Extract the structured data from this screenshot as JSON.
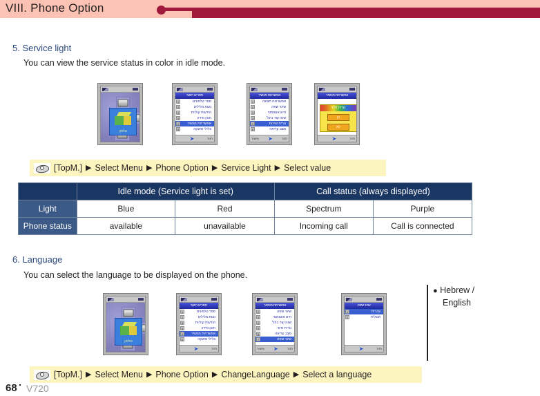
{
  "header": {
    "title": "VIII. Phone Option",
    "band_color": "#fcc3b4",
    "accent_color": "#a0183c"
  },
  "sections": [
    {
      "id": "service-light",
      "heading": "5. Service light",
      "description": "You can view the service status in color in idle mode."
    },
    {
      "id": "language",
      "heading": "6. Language",
      "description": "You can select the language to be displayed on the phone."
    }
  ],
  "phones_service_light": [
    {
      "type": "idle",
      "icon_label": "טלפון",
      "status_signal": "signal-icon",
      "status_battery": "battery-icon"
    },
    {
      "type": "menu",
      "title": "תפריט ראשי",
      "items": [
        {
          "num": "1",
          "text": "ספר טלפונים",
          "selected": false
        },
        {
          "num": "2",
          "text": "נעות מלילים",
          "selected": false
        },
        {
          "num": "3",
          "text": "הודעות קוליות",
          "selected": false
        },
        {
          "num": "4",
          "text": "תוכן מידע",
          "selected": false
        },
        {
          "num": "5",
          "text": "אפשרויות מכשיר",
          "selected": true
        },
        {
          "num": "6",
          "text": "צלילי אזעקה",
          "selected": false
        }
      ],
      "soft_left": "",
      "soft_right": "חזור"
    },
    {
      "type": "menu",
      "title": "אפשרויות מכשיר",
      "items": [
        {
          "num": "1",
          "text": "אפשרויות תצוגה",
          "selected": false
        },
        {
          "num": "2",
          "text": "שינוי שפה",
          "selected": false
        },
        {
          "num": "3",
          "text": "חיוג אוטומטי",
          "selected": false
        },
        {
          "num": "4",
          "text": "שנה קוד בינל'",
          "selected": false
        },
        {
          "num": "5",
          "text": "נורית שירות",
          "selected": true
        },
        {
          "num": "6",
          "text": "מצב קריאה",
          "selected": false
        }
      ],
      "soft_left": "אישור",
      "soft_right": "חזור"
    },
    {
      "type": "popup",
      "title": "אפשרויות מכשיר",
      "popup_title": "נורית חיווי",
      "buttons": [
        "כן",
        "לא"
      ],
      "soft_left": "",
      "soft_right": "חזור"
    }
  ],
  "nav_service_light": {
    "icon": "mouse-click-icon",
    "steps": [
      "[TopM.]",
      "Select Menu",
      "Phone Option",
      "Service Light",
      "Select value"
    ],
    "separator": "▶"
  },
  "table": {
    "group_headers": [
      {
        "label": "",
        "span": 1
      },
      {
        "label": "Idle mode (Service light is set)",
        "span": 2
      },
      {
        "label": "Call status (always displayed)",
        "span": 2
      }
    ],
    "rows": [
      {
        "label": "Light",
        "cells": [
          "Blue",
          "Red",
          "Spectrum",
          "Purple"
        ]
      },
      {
        "label": "Phone status",
        "cells": [
          "available",
          "unavailable",
          "Incoming call",
          "Call is connected"
        ]
      }
    ],
    "header_color": "#1a3663",
    "rowhdr_color": "#3c5a87"
  },
  "phones_language": [
    {
      "type": "idle",
      "icon_label": "טלפון"
    },
    {
      "type": "menu",
      "title": "תפריט ראשי",
      "items": [
        {
          "num": "1",
          "text": "ספר טלפונים",
          "selected": false
        },
        {
          "num": "2",
          "text": "נעות מלילים",
          "selected": false
        },
        {
          "num": "3",
          "text": "הודעות קוליות",
          "selected": false
        },
        {
          "num": "4",
          "text": "תוכן מידע",
          "selected": false
        },
        {
          "num": "5",
          "text": "אפשרויות מכשיר",
          "selected": true
        },
        {
          "num": "6",
          "text": "צלילי אזעקה",
          "selected": false
        }
      ],
      "soft_left": "",
      "soft_right": "חזור"
    },
    {
      "type": "menu",
      "title": "אפשרויות מכשיר",
      "items": [
        {
          "num": "2",
          "text": "שינוי שפה",
          "selected": false
        },
        {
          "num": "3",
          "text": "חיוג אוטומטי",
          "selected": false
        },
        {
          "num": "4",
          "text": "שנה קוד בינל'",
          "selected": false
        },
        {
          "num": "5",
          "text": "נורית חיווי",
          "selected": false
        },
        {
          "num": "6",
          "text": "מצב קריאה",
          "selected": false
        },
        {
          "num": "7",
          "text": "שינוי שפה",
          "selected": true
        }
      ],
      "soft_left": "אישור",
      "soft_right": "חזור"
    },
    {
      "type": "menu",
      "title": "שינוי שפה",
      "items": [
        {
          "num": "1",
          "text": "עברית",
          "selected": true
        },
        {
          "num": "2",
          "text": "אנגלית",
          "selected": false
        }
      ],
      "soft_left": "",
      "soft_right": "חזור"
    }
  ],
  "nav_language": {
    "icon": "mouse-click-icon",
    "steps": [
      "[TopM.]",
      "Select Menu",
      "Phone Option",
      "ChangeLanguage",
      "Select a language"
    ],
    "separator": "▶"
  },
  "note": {
    "bullet": "●",
    "line1": "Hebrew /",
    "line2": "English"
  },
  "footer": {
    "page": "68",
    "model": "V720"
  }
}
